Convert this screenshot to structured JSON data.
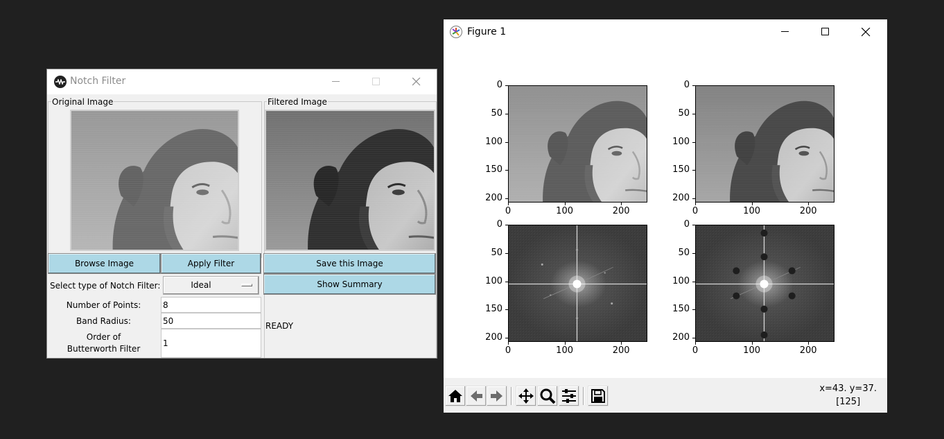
{
  "notch_window": {
    "title": "Notch Filter",
    "original_group_label": "Original Image",
    "filtered_group_label": "Filtered Image",
    "browse_button": "Browse Image",
    "apply_button": "Apply Filter",
    "save_button": "Save this Image",
    "summary_button": "Show Summary",
    "filter_type_label": "Select type of Notch Filter:",
    "filter_type_value": "Ideal",
    "num_points_label": "Number of Points:",
    "num_points_value": "8",
    "band_radius_label": "Band Radius:",
    "band_radius_value": "50",
    "order_label_line1": "Order of",
    "order_label_line2": "Butterworth Filter",
    "order_value": "1",
    "status": "READY",
    "accent_button_color": "#add8e6"
  },
  "figure_window": {
    "title": "Figure 1",
    "coordinates_line1": "x=43. y=37.",
    "coordinates_line2": "[125]",
    "toolbar_icons": [
      "home-icon",
      "back-arrow-icon",
      "forward-arrow-icon",
      "pan-icon",
      "zoom-icon",
      "configure-subplots-icon",
      "save-icon"
    ]
  },
  "chart_data": [
    {
      "type": "image",
      "content": "original image (spatial domain)",
      "x_ticks": [
        "0",
        "100",
        "200"
      ],
      "y_ticks": [
        "0",
        "50",
        "100",
        "150",
        "200"
      ]
    },
    {
      "type": "image",
      "content": "filtered image (spatial domain)",
      "x_ticks": [
        "0",
        "100",
        "200"
      ],
      "y_ticks": [
        "0",
        "50",
        "100",
        "150",
        "200"
      ]
    },
    {
      "type": "image",
      "content": "original spectrum (log magnitude)",
      "x_ticks": [
        "0",
        "100",
        "200"
      ],
      "y_ticks": [
        "0",
        "50",
        "100",
        "150",
        "200"
      ]
    },
    {
      "type": "image",
      "content": "filtered spectrum with 8 notches",
      "x_ticks": [
        "0",
        "100",
        "200"
      ],
      "y_ticks": [
        "0",
        "50",
        "100",
        "150",
        "200"
      ]
    }
  ]
}
